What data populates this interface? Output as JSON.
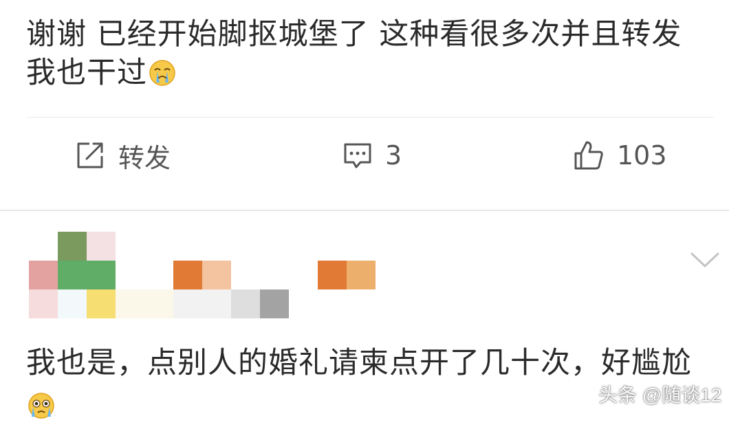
{
  "post": {
    "text": "谢谢 已经开始脚抠城堡了 这种看很多次并且转发我也干过",
    "emoji": "crying-face"
  },
  "actions": {
    "repost_label": "转发",
    "comment_count": "3",
    "like_count": "103"
  },
  "comment": {
    "text": "我也是，点别人的婚礼请柬点开了几十次，好尴尬",
    "emoji": "crying-face"
  },
  "watermark": "头条 @随谈12",
  "colors": {
    "text": "#2a2a2a",
    "icon": "#555555",
    "divider": "#e6e6e6"
  }
}
